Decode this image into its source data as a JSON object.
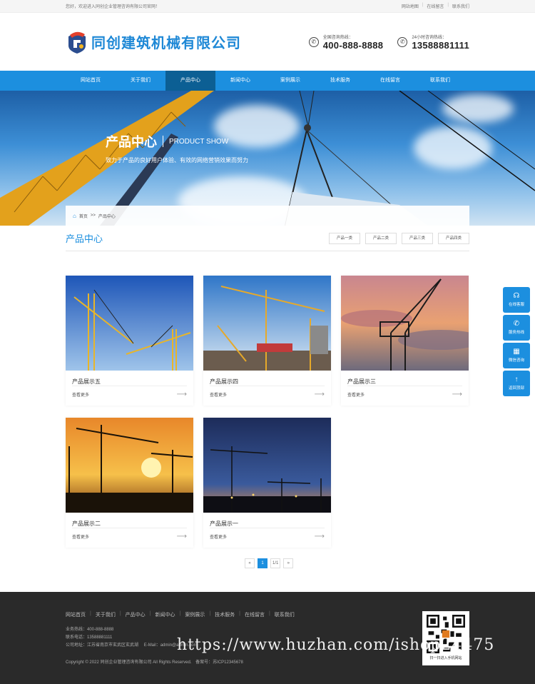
{
  "topbar": {
    "welcome": "您好，欢迎进入同创企业管理咨询有限公司官网！",
    "links": [
      "网站地图",
      "在线留言",
      "联系我们"
    ]
  },
  "header": {
    "company_name": "同创建筑机械有限公司",
    "hotline1_label": "全国咨询热线：",
    "hotline1_number": "400-888-8888",
    "hotline2_label": "24小时咨询热线：",
    "hotline2_number": "13588881111"
  },
  "nav": {
    "items": [
      "网站首页",
      "关于我们",
      "产品中心",
      "新闻中心",
      "案例展示",
      "技术服务",
      "在线留言",
      "联系我们"
    ],
    "active_index": 2
  },
  "banner": {
    "title_cn": "产品中心",
    "title_en": "PRODUCT SHOW",
    "subtitle": "致力于产品的良好用户体验、有效的网络营销效果而努力"
  },
  "breadcrumb": {
    "home": "首页",
    "separator": ">>",
    "current": "产品中心"
  },
  "section": {
    "title": "产品中心",
    "categories": [
      "产品一类",
      "产品二类",
      "产品三类",
      "产品四类"
    ]
  },
  "products": [
    {
      "name": "产品展示五",
      "more": "查看更多",
      "scene": "blue-sky"
    },
    {
      "name": "产品展示四",
      "more": "查看更多",
      "scene": "site-day"
    },
    {
      "name": "产品展示三",
      "more": "查看更多",
      "scene": "sunset-clouds"
    },
    {
      "name": "产品展示二",
      "more": "查看更多",
      "scene": "orange-sunset"
    },
    {
      "name": "产品展示一",
      "more": "查看更多",
      "scene": "night-city"
    }
  ],
  "pagination": {
    "prev": "«",
    "current": "1",
    "total": "1/1",
    "next": "»"
  },
  "side_service": {
    "items": [
      {
        "label": "在线客服",
        "icon": "headset-icon",
        "glyph": "☊"
      },
      {
        "label": "服务热线",
        "icon": "phone-icon",
        "glyph": "✆"
      },
      {
        "label": "微信咨询",
        "icon": "qrcode-icon",
        "glyph": "▦"
      },
      {
        "label": "返回顶部",
        "icon": "arrow-up-icon",
        "glyph": "↑"
      }
    ]
  },
  "footer": {
    "nav": [
      "网站首页",
      "关于我们",
      "产品中心",
      "新闻中心",
      "案例展示",
      "技术服务",
      "在线留言",
      "联系我们"
    ],
    "hotline": "业务热线：400-888-8888",
    "phone": "联系电话：13588881111",
    "address": "公司地址：江苏省南京市玄武区玄武湖",
    "email": "E-Mail：admin@admin.com",
    "copyright": "Copyright © 2022 同创企业管理咨询有限公司 All Rights Reserved.",
    "icp": "备案号：苏ICP12345678",
    "qr_caption": "扫一扫进入手机网站"
  },
  "watermark": "https://www.huzhan.com/ishop24475",
  "colors": {
    "accent": "#1c8fdf",
    "nav_active": "#0c5f94",
    "footer_bg": "#2a2a2a"
  }
}
